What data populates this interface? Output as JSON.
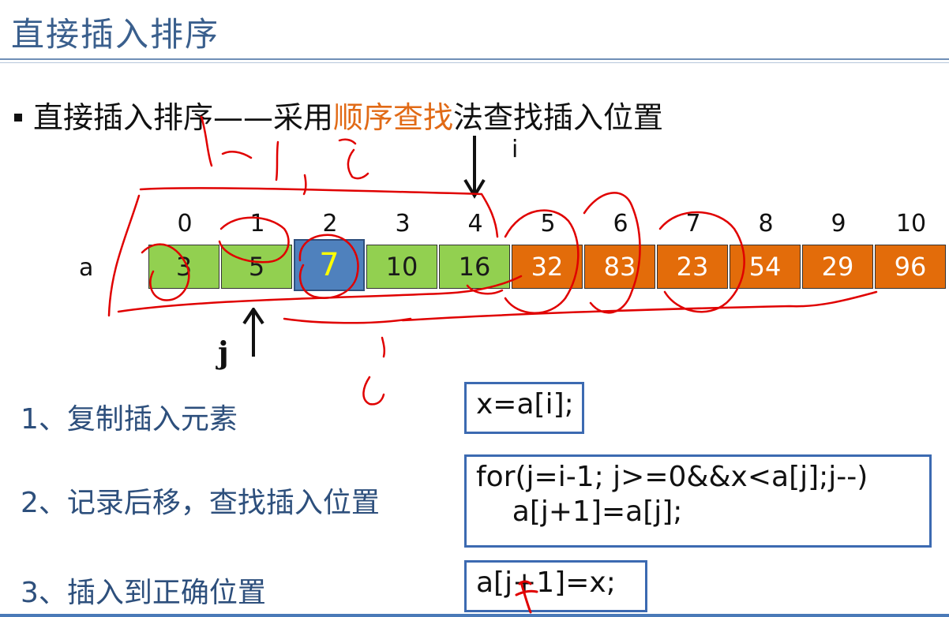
{
  "slide": {
    "title": "直接插入排序",
    "bullet_pre": "直接插入排序——采用",
    "bullet_highlight": "顺序查找",
    "bullet_post": "法查找插入位置"
  },
  "pointers": {
    "i_label": "i",
    "j_label": "j"
  },
  "array": {
    "name": "a",
    "indices": [
      "0",
      "1",
      "2",
      "3",
      "4",
      "5",
      "6",
      "7",
      "8",
      "9",
      "10"
    ],
    "values": [
      "3",
      "5",
      "7",
      "10",
      "16",
      "32",
      "83",
      "23",
      "54",
      "29",
      "96"
    ],
    "states": [
      "green",
      "green",
      "blue",
      "green",
      "green",
      "orange",
      "orange",
      "orange",
      "orange",
      "orange",
      "orange"
    ],
    "colors": {
      "sorted": "#92d050",
      "current": "#4f81bd",
      "unsorted": "#e36c0a",
      "current_text": "#ffff00"
    }
  },
  "steps": [
    {
      "label": "1、复制插入元素",
      "code": "x=a[i];"
    },
    {
      "label": "2、记录后移，查找插入位置",
      "code_line1": "for(j=i-1; j>=0&&x<a[j];j--)",
      "code_line2": "    a[j+1]=a[j];"
    },
    {
      "label": "3、插入到正确位置",
      "code": "a[j+1]=x;"
    }
  ],
  "annotation_color": "#e00000"
}
